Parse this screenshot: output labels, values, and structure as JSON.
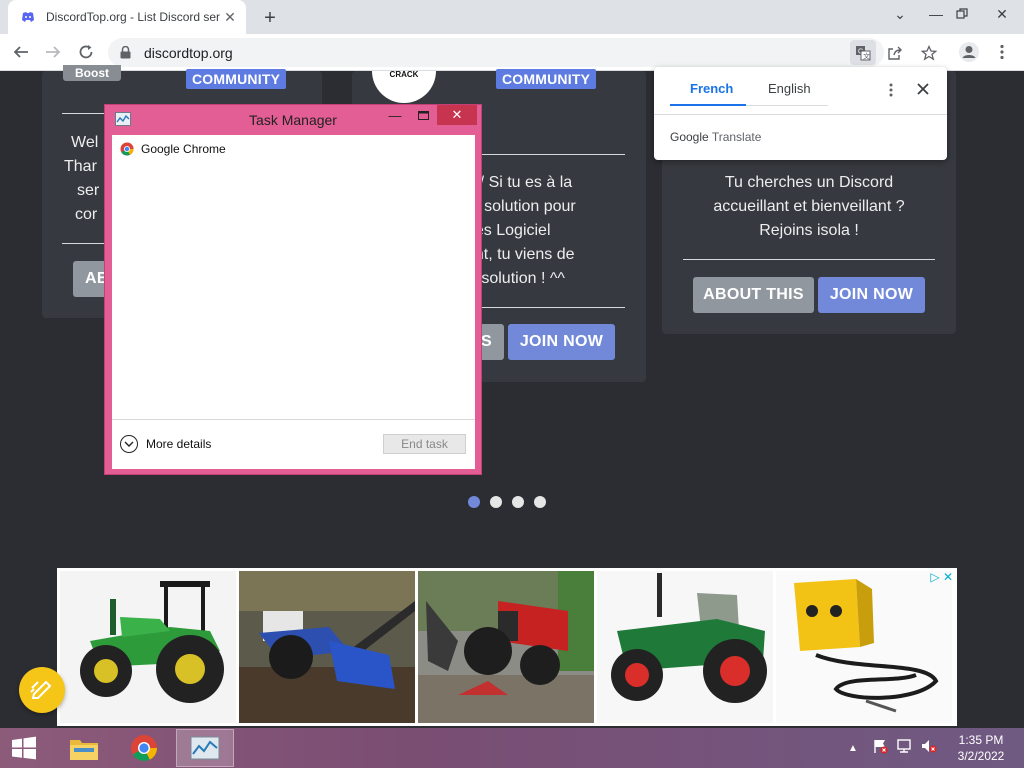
{
  "browser": {
    "tab_title": "DiscordTop.org - List Discord ser",
    "new_tab": "+",
    "url": "discordtop.org",
    "window_controls": [
      "minimize",
      "restore",
      "close"
    ]
  },
  "cards": [
    {
      "boost_label": "Boost",
      "badge": "COMMUNITY",
      "description_lines": [
        "Wel",
        "Thar",
        "ser",
        "cor"
      ],
      "about_label": "AB",
      "join_label": ""
    },
    {
      "logo_text": "CRACK",
      "badge": "COMMUNITY",
      "description_lines": [
        "erv / Si tu es à la",
        "une solution pour",
        "des Logiciel",
        "ent, tu viens de",
        "a solution ! ^^"
      ],
      "about_label": "S",
      "join_label": "JOIN NOW"
    },
    {
      "description_lines": [
        "Tu cherches un Discord",
        "accueillant et bienveillant ?",
        "Rejoins isola !"
      ],
      "about_label": "ABOUT THIS",
      "join_label": "JOIN NOW"
    }
  ],
  "carousel": {
    "dots": 4,
    "active_index": 0
  },
  "translate_popup": {
    "languages": [
      "French",
      "English"
    ],
    "active_language": "French",
    "brand_google": "Google",
    "brand_translate": "Translate"
  },
  "ad": {
    "close_marks": "▷ ✕",
    "images": [
      "green-tractor",
      "blue-rotary-tiller",
      "red-walking-tractor",
      "green-red-tractor",
      "yellow-welder"
    ]
  },
  "task_manager": {
    "title": "Task Manager",
    "processes": [
      "Google Chrome"
    ],
    "more_details": "More details",
    "end_task": "End task"
  },
  "taskbar": {
    "time": "1:35 PM",
    "date": "3/2/2022",
    "apps": [
      "file-explorer",
      "google-chrome",
      "task-manager"
    ],
    "active_app": "task-manager"
  },
  "colors": {
    "page_bg": "#2b2d33",
    "card_bg": "#36393f",
    "join_button": "#7289da",
    "about_button": "#90979e",
    "badge": "#5d7be0",
    "taskmgr_frame": "#e35e95",
    "taskmgr_close": "#c7344f"
  }
}
